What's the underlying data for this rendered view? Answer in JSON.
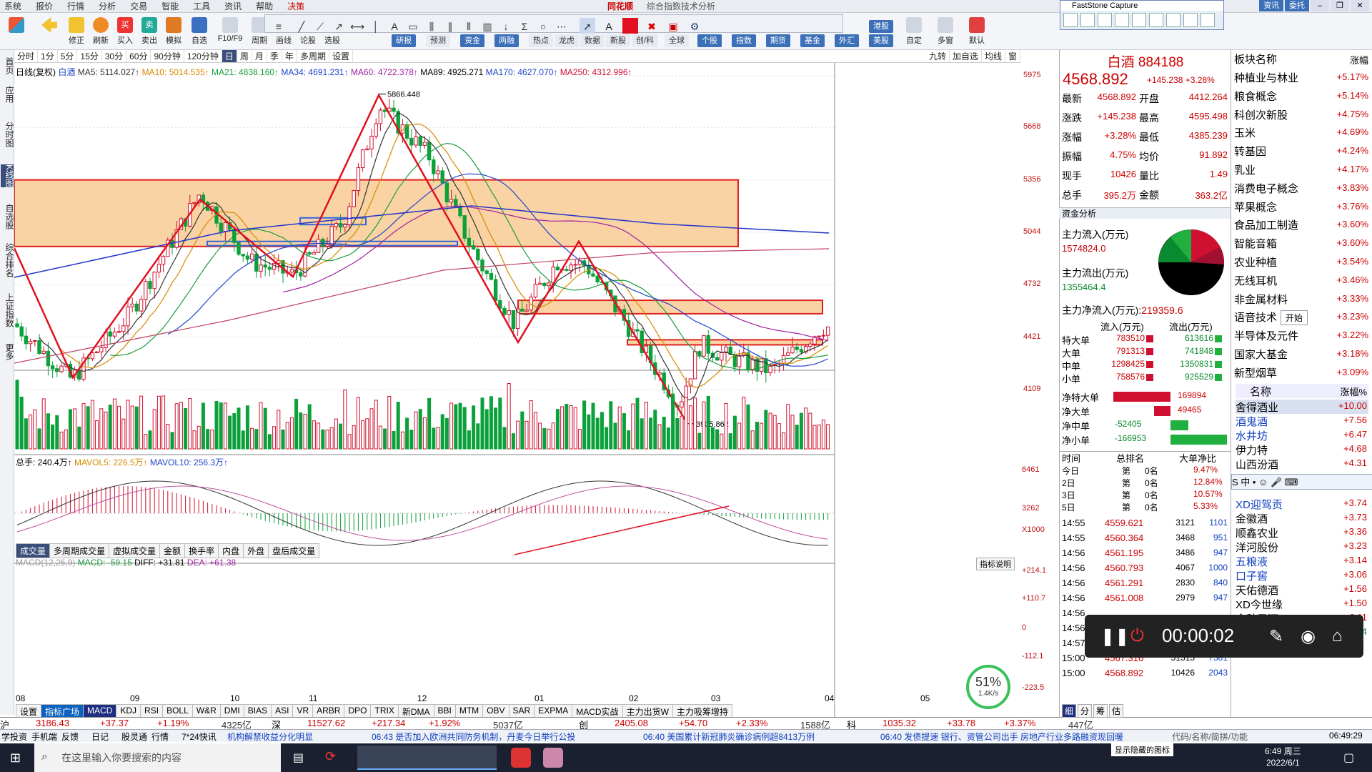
{
  "menu": [
    "系统",
    "报价",
    "行情",
    "分析",
    "交易",
    "智能",
    "工具",
    "资讯",
    "帮助",
    "决策"
  ],
  "window_title": "同花顺",
  "window_subtitle": "综合指数技术分析",
  "toolbar": {
    "buttons": [
      "修正",
      "刷新",
      "买入",
      "卖出",
      "模拟",
      "自选",
      "F10/F9",
      "周期",
      "画线",
      "论股",
      "选股"
    ],
    "tabs": [
      "研报",
      "预测",
      "资金",
      "两融",
      "热点",
      "龙虎",
      "数据",
      "新股",
      "创/科",
      "全球",
      "个股",
      "指数",
      "期货",
      "基金",
      "外汇",
      "港股",
      "美股"
    ],
    "right_buttons": [
      "自定",
      "多窗",
      "默认"
    ]
  },
  "capture": {
    "title": "FastStone Capture"
  },
  "top_right": {
    "pill1": "资讯",
    "pill2": "委托"
  },
  "leftbar": [
    "首页",
    "应用",
    "分时图",
    "K线图",
    "自选股",
    "综合排名",
    "上证指数",
    "更多"
  ],
  "periods": [
    "分时",
    "1分",
    "5分",
    "15分",
    "30分",
    "60分",
    "90分钟",
    "120分钟",
    "日",
    "周",
    "月",
    "季",
    "年",
    "多周期",
    "设置"
  ],
  "period_selected": "日",
  "period_right": [
    "九转",
    "加自选",
    "均线",
    "窗"
  ],
  "ma_line": {
    "label": "日线(复权)",
    "name": "白酒",
    "ma5": "MA5: 5114.027↑",
    "ma10": "MA10: 5014.535↑",
    "ma21": "MA21: 4838.160↑",
    "ma34": "MA34: 4691.231↑",
    "ma60": "MA60: 4722.378↑",
    "ma89": "MA89: 4925.271",
    "ma170": "MA170: 4627.070↑",
    "ma250": "MA250: 4312.996↑"
  },
  "chart_annotations": {
    "high": "5866.448",
    "low": "3905.862"
  },
  "y_axis": [
    "5975",
    "5668",
    "5356",
    "5044",
    "4732",
    "4421",
    "4109"
  ],
  "vol_axis": [
    "6461",
    "3262",
    "X1000"
  ],
  "macd_axis": [
    "+214.1",
    "+110.7",
    "0",
    "-112.1",
    "-223.5"
  ],
  "x_axis": [
    "08",
    "09",
    "10",
    "11",
    "12",
    "01",
    "02",
    "03",
    "04",
    "05"
  ],
  "vol_info": {
    "total": "总手: 240.4万↑",
    "mavol5": "MAVOL5: 226.5万↑",
    "mavol10": "MAVOL10: 256.3万↑"
  },
  "vol_tabs": [
    "成交量",
    "多周期成交量",
    "虚拟成交量",
    "金额",
    "换手率",
    "内盘",
    "外盘",
    "盘后成交量"
  ],
  "macd_info": {
    "label": "MACD(12,26,9)",
    "macd": "MACD: -59.15",
    "diff": "DIFF: +31.81",
    "dea": "DEA: +61.38"
  },
  "indicator_button": "指标说明",
  "indicator_tabs": [
    "设置",
    "指标广场",
    "MACD",
    "KDJ",
    "RSI",
    "BOLL",
    "W&R",
    "DMI",
    "BIAS",
    "ASI",
    "VR",
    "ARBR",
    "DPO",
    "TRIX",
    "新DMA",
    "BBI",
    "MTM",
    "OBV",
    "SAR",
    "EXPMA",
    "MACD实战",
    "主力出货W",
    "主力吸筹增持"
  ],
  "quote": {
    "name": "白酒 884188",
    "price": "4568.892",
    "change": "+145.238 +3.28%",
    "rows": [
      [
        "最新",
        "4568.892",
        "开盘",
        "4412.264"
      ],
      [
        "涨跌",
        "+145.238",
        "最高",
        "4595.498"
      ],
      [
        "涨幅",
        "+3.28%",
        "最低",
        "4385.239"
      ],
      [
        "振幅",
        "4.75%",
        "均价",
        "91.892"
      ],
      [
        "现手",
        "10426",
        "量比",
        "1.49"
      ],
      [
        "总手",
        "395.2万",
        "金额",
        "363.2亿"
      ]
    ],
    "fund_title": "资金分析",
    "fund_in_label": "主力流入(万元)",
    "fund_in": "1574824.0",
    "fund_out_label": "主力流出(万元)",
    "fund_out": "1355464.4",
    "net_label": "主力净流入(万元):",
    "net": "219359.6",
    "flow_head": [
      "流入(万元)",
      "流出(万元)"
    ],
    "flows": [
      [
        "特大单",
        "783510",
        "613616"
      ],
      [
        "大单",
        "791313",
        "741848"
      ],
      [
        "中单",
        "1298425",
        "1350831"
      ],
      [
        "小单",
        "758576",
        "925529"
      ]
    ],
    "nets": [
      [
        "净特大单",
        "169894"
      ],
      [
        "净大单",
        "49465"
      ],
      [
        "净中单",
        "-52405"
      ],
      [
        "净小单",
        "-166953"
      ]
    ],
    "rank_head": [
      "时间",
      "总排名",
      "大单净比"
    ],
    "ranks": [
      [
        "今日",
        "第",
        "0名",
        "9.47%"
      ],
      [
        "2日",
        "第",
        "0名",
        "12.84%"
      ],
      [
        "3日",
        "第",
        "0名",
        "10.57%"
      ],
      [
        "5日",
        "第",
        "0名",
        "5.33%"
      ]
    ],
    "ticks": [
      [
        "14:55",
        "4559.621",
        "3121",
        "1101"
      ],
      [
        "14:55",
        "4560.364",
        "3468",
        "951"
      ],
      [
        "14:56",
        "4561.195",
        "3486",
        "947"
      ],
      [
        "14:56",
        "4560.793",
        "4067",
        "1000"
      ],
      [
        "14:56",
        "4561.291",
        "2830",
        "840"
      ],
      [
        "14:56",
        "4561.008",
        "2979",
        "947"
      ],
      [
        "14:56",
        "",
        "",
        ""
      ],
      [
        "14:56",
        "",
        "",
        ""
      ],
      [
        "14:57",
        "4561.271",
        "3349",
        "800"
      ],
      [
        "15:00",
        "4567.316",
        "51515",
        "7381"
      ],
      [
        "15:00",
        "4568.892",
        "10426",
        "2043"
      ]
    ],
    "bottom_tabs": [
      "细",
      "分",
      "筹",
      "估"
    ]
  },
  "sectors_head": [
    "板块名称",
    "涨幅"
  ],
  "sectors": [
    [
      "种植业与林业",
      "+5.17%"
    ],
    [
      "粮食概念",
      "+5.14%"
    ],
    [
      "科创次新股",
      "+4.75%"
    ],
    [
      "玉米",
      "+4.69%"
    ],
    [
      "转基因",
      "+4.24%"
    ],
    [
      "乳业",
      "+4.17%"
    ],
    [
      "消费电子概念",
      "+3.83%"
    ],
    [
      "苹果概念",
      "+3.76%"
    ],
    [
      "食品加工制造",
      "+3.60%"
    ],
    [
      "智能音箱",
      "+3.60%"
    ],
    [
      "农业种植",
      "+3.54%"
    ],
    [
      "无线耳机",
      "+3.46%"
    ],
    [
      "非金属材料",
      "+3.33%"
    ],
    [
      "语音技术",
      "+3.23%"
    ],
    [
      "半导体及元件",
      "+3.22%"
    ],
    [
      "国家大基金",
      "+3.18%"
    ],
    [
      "新型烟草",
      "+3.09%"
    ]
  ],
  "stocks_head": [
    "名称",
    "涨幅%"
  ],
  "stocks": [
    [
      "舍得酒业",
      "+10.00",
      false
    ],
    [
      "酒鬼酒",
      "+7.56",
      true
    ],
    [
      "水井坊",
      "+6.47",
      true
    ],
    [
      "伊力特",
      "+4.68",
      false
    ],
    [
      "山西汾酒",
      "+4.31",
      false
    ],
    [
      "XD迎驾贡",
      "+3.74",
      true
    ],
    [
      "金徽酒",
      "+3.73",
      false
    ],
    [
      "顺鑫农业",
      "+3.36",
      false
    ],
    [
      "洋河股份",
      "+3.23",
      false
    ],
    [
      "五粮液",
      "+3.14",
      true
    ],
    [
      "口子窖",
      "+3.06",
      true
    ],
    [
      "天佑德酒",
      "+1.56",
      false
    ],
    [
      "XD今世缘",
      "+1.50",
      false
    ],
    [
      "金种子酒",
      "+0.11",
      false
    ],
    [
      "*ST皇台",
      "-1.74",
      false
    ]
  ],
  "recorder": {
    "time": "00:00:02",
    "start": "开始"
  },
  "ticker": [
    [
      "沪",
      "3186.43",
      "+37.37",
      "+1.19%",
      "4325亿"
    ],
    [
      "深",
      "11527.62",
      "+217.34",
      "+1.92%",
      "5037亿"
    ],
    [
      "创",
      "2405.08",
      "+54.70",
      "+2.33%",
      "1588亿"
    ],
    [
      "科",
      "1035.32",
      "+33.78",
      "+3.37%",
      "447亿"
    ]
  ],
  "news": {
    "left": [
      "学投资",
      "手机端",
      "反馈",
      "日记",
      "股灵通",
      "行情",
      "7*24快讯"
    ],
    "items": [
      "机构解禁收益分化明显",
      "06:43 是否加入欧洲共同防务机制，丹麦今日举行公投",
      "06:40 美国累计新冠肺炎确诊病例超8413万例",
      "06:40 发债提速 银行、资管公司出手 房地产行业多路融资现回暖"
    ],
    "right": "代码/名称/简拼/功能",
    "time": "06:49:29"
  },
  "taskbar": {
    "search": "在这里输入你要搜索的内容",
    "time": "6:49 周三",
    "date": "2022/6/1",
    "tip": "显示隐藏的图标"
  },
  "badge": {
    "pct": "51%",
    "speed": "1.4K/s"
  },
  "colors": {
    "up": "#d01030",
    "down": "#0aa03a",
    "zone": "#f8c88c"
  }
}
